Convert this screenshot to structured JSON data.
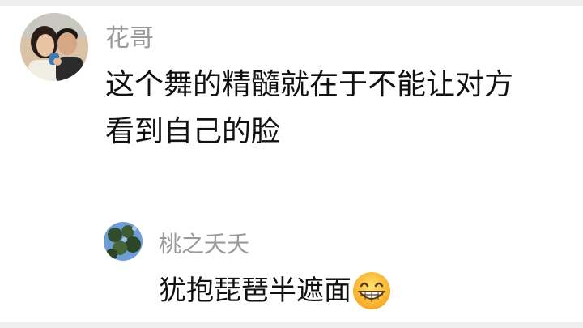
{
  "comments": [
    {
      "username": "花哥",
      "lines": [
        "这个舞的精髓就在于不能让对方",
        "看到自己的脸"
      ],
      "avatar_icon": "couple-photo-avatar"
    },
    {
      "username": "桃之夭夭",
      "text": "犹抱琵琶半遮面",
      "avatar_icon": "tree-photo-avatar",
      "emoji_icon": "grinning-face-emoji"
    }
  ]
}
